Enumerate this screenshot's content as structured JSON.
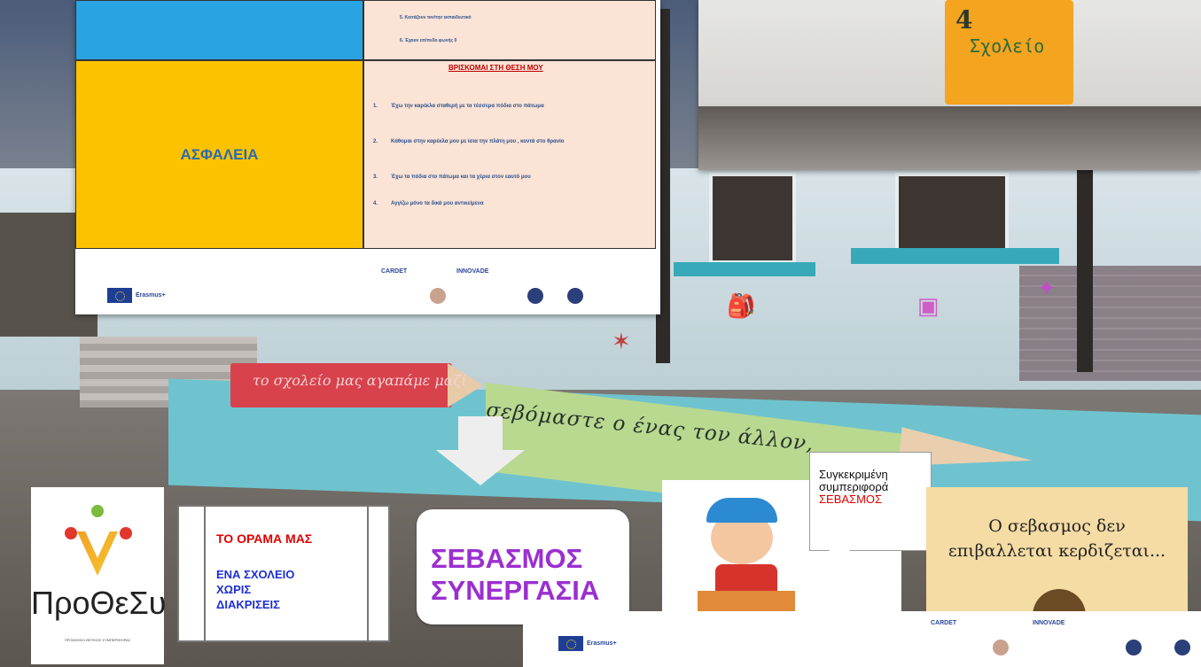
{
  "slide": {
    "row1_items": [
      "5. Κοιτάζουν τον/την εκπαιδευτικό",
      "6. Έχουν επίπεδο φωνής 0"
    ],
    "section_label": "ΑΣΦΑΛΕΙΑ",
    "heading": "ΒΡΙΣΚΟΜΑΙ ΣΤΗ ΘΕΣΗ ΜΟΥ",
    "items": [
      {
        "n": "1.",
        "text": "Έχω την καρέκλα σταθερή με τα τέσσερα πόδια στο πάτωμα"
      },
      {
        "n": "2.",
        "text": "Κάθομαι στην καρέκλα μου με ίσια την πλάτη μου , κοντά στο θρανίο"
      },
      {
        "n": "3.",
        "text": "Έχω τα πόδια στο πάτωμα και τα χέρια στον εαυτό μου"
      },
      {
        "n": "4.",
        "text": "Αγγίζω μόνο τα δικά μου αντικείμενα"
      }
    ],
    "footer_erasmus": "Erasmus+",
    "footer_partners": [
      "CARDET",
      "INNOVADE"
    ]
  },
  "door_photo": {
    "sign_number": "4",
    "sign_text": "Σχολείο"
  },
  "wall": {
    "red_pencil_text": "το σχολείο μας αγαπάμε μαζί",
    "green_pencil_text": "σεβόμαστε ο ένας τον άλλον,"
  },
  "logo": {
    "name": "ΠροΘεΣυ",
    "subtitle": "ΠΡΟΩΘΗΣΗ ΘΕΤΙΚΗΣ ΣΥΜΠΕΡΙΦΟΡΑΣ"
  },
  "vision": {
    "title": "ΤΟ ΟΡΑΜΑ ΜΑΣ",
    "line1": "ΕΝΑ ΣΧΟΛΕΙΟ",
    "line2": "ΧΩΡΙΣ",
    "line3": "ΔΙΑΚΡΙΣΕΙΣ"
  },
  "values": {
    "line1": "ΣΕΒΑΣΜΟΣ",
    "line2": "ΣΥΝΕΡΓΑΣΙΑ"
  },
  "callout": {
    "line1": "Συγκεκριμένη",
    "line2": "συμπεριφορά",
    "line3": "ΣΕΒΑΣΜΟΣ"
  },
  "quote": {
    "line1": "Ο σεβασμος δεν",
    "line2": "επιβαλλεται κερδιζεται..."
  },
  "footer2": {
    "erasmus": "Erasmus+",
    "partners": [
      "CARDET",
      "INNOVADE"
    ]
  }
}
